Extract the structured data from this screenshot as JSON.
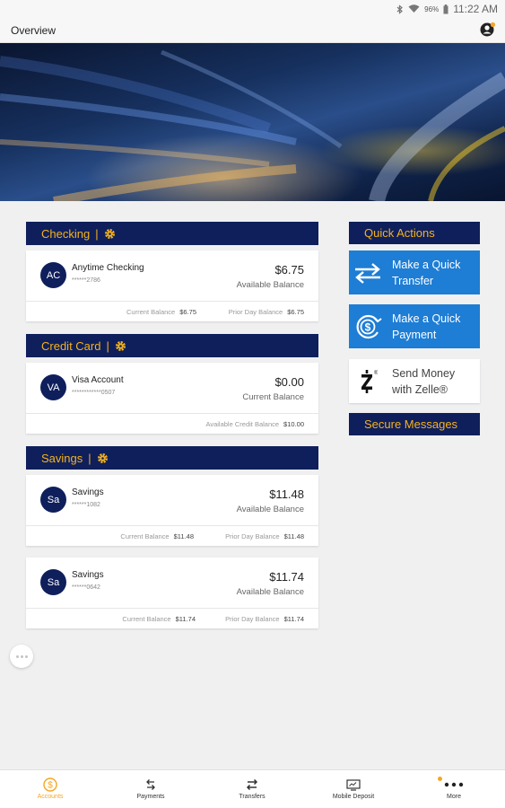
{
  "status_bar": {
    "battery": "96%",
    "time": "11:22 AM"
  },
  "app_bar": {
    "title": "Overview"
  },
  "sections": [
    {
      "title": "Checking"
    },
    {
      "title": "Credit Card"
    },
    {
      "title": "Savings"
    }
  ],
  "accounts": [
    {
      "initials": "AC",
      "name": "Anytime Checking",
      "mask": "******2786",
      "amount": "$6.75",
      "amount_label": "Available Balance",
      "left_label": "Current Balance",
      "left_value": "$6.75",
      "right_label": "Prior Day Balance",
      "right_value": "$6.75"
    },
    {
      "initials": "VA",
      "name": "Visa Account",
      "mask": "************0507",
      "amount": "$0.00",
      "amount_label": "Current Balance",
      "left_label": "",
      "left_value": "",
      "right_label": "Available Credit Balance",
      "right_value": "$10.00"
    },
    {
      "initials": "Sa",
      "name": "Savings",
      "mask": "******1082",
      "amount": "$11.48",
      "amount_label": "Available Balance",
      "left_label": "Current Balance",
      "left_value": "$11.48",
      "right_label": "Prior Day Balance",
      "right_value": "$11.48"
    },
    {
      "initials": "Sa",
      "name": "Savings",
      "mask": "******0642",
      "amount": "$11.74",
      "amount_label": "Available Balance",
      "left_label": "Current Balance",
      "left_value": "$11.74",
      "right_label": "Prior Day Balance",
      "right_value": "$11.74"
    }
  ],
  "quick_actions": {
    "title": "Quick Actions",
    "transfer_line1": "Make a Quick",
    "transfer_line2": "Transfer",
    "payment_line1": "Make a Quick",
    "payment_line2": "Payment",
    "zelle_line1": "Send Money",
    "zelle_line2": "with Zelle®",
    "secure_messages": "Secure Messages"
  },
  "nav": [
    {
      "label": "Accounts",
      "icon": "dollar-circle-icon"
    },
    {
      "label": "Payments",
      "icon": "payments-arrows-icon"
    },
    {
      "label": "Transfers",
      "icon": "transfer-arrows-icon"
    },
    {
      "label": "Mobile Deposit",
      "icon": "check-deposit-icon"
    },
    {
      "label": "More",
      "icon": "more-dots-icon"
    }
  ],
  "colors": {
    "navy": "#0f1f5c",
    "gold": "#f5b31c",
    "blue": "#1e7dd4",
    "active_tab": "#f5a623"
  }
}
